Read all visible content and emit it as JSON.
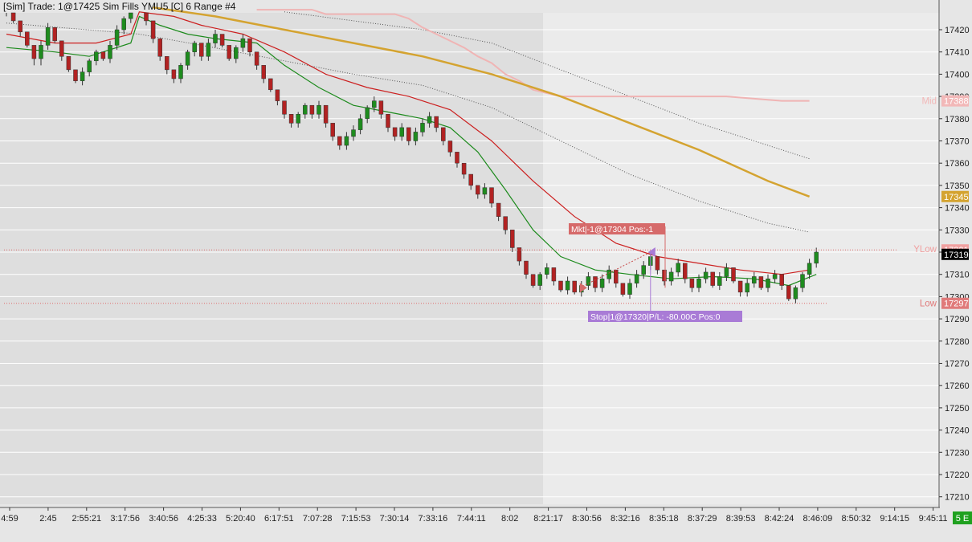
{
  "header": {
    "title": "[Sim]  Trade: 1@17425   Sim Fills  YMU5 [C]  6 Range  #4"
  },
  "price_axis": {
    "ticks": [
      "17420",
      "17410",
      "17400",
      "17390",
      "17380",
      "17370",
      "17360",
      "17350",
      "17340",
      "17330",
      "17320",
      "17310",
      "17300",
      "17290",
      "17280",
      "17270",
      "17260",
      "17250",
      "17240",
      "17230",
      "17220",
      "17210"
    ],
    "tags": {
      "mid": {
        "label": "Mid",
        "value": "17388",
        "color": "#f2b8b8"
      },
      "yellow_ma": {
        "value": "17345",
        "color": "#d4a330"
      },
      "ylow": {
        "label": "YLow",
        "value": "17321",
        "color": "#f0a0a0"
      },
      "last": {
        "value": "17319",
        "color": "#000000"
      },
      "low": {
        "label": "Low",
        "value": "17297",
        "color": "#e07a7a"
      }
    }
  },
  "time_axis": {
    "labels": [
      "4:59",
      "2:45",
      "2:55:21",
      "3:17:56",
      "3:40:56",
      "4:25:33",
      "5:20:40",
      "6:17:51",
      "7:07:28",
      "7:15:53",
      "7:30:14",
      "7:33:16",
      "7:44:11",
      "8:02",
      "8:21:17",
      "8:30:56",
      "8:32:16",
      "8:35:18",
      "8:37:29",
      "8:39:53",
      "8:42:24",
      "8:46:09",
      "8:50:32",
      "9:14:15",
      "9:45:11"
    ],
    "corner_label": "5 E"
  },
  "annotations": {
    "entry_label": "Mkt|-1@17304 Pos:-1",
    "exit_label": "Stop|1@17320|P/L: -80.00C Pos:0"
  },
  "colors": {
    "up_candle": "#1e8c1e",
    "down_candle": "#b22222",
    "green_ma": "#1c8a1c",
    "red_ma": "#cc2020",
    "yellow_ma": "#d4a330",
    "grey_ma": "#555555",
    "entry_color": "#d66a6a",
    "exit_color": "#a97bd6"
  },
  "chart_data": {
    "type": "candlestick",
    "instrument": "YMU5",
    "bar_type": "6 Range",
    "ylim": [
      17204,
      17430
    ],
    "grid": true,
    "legend": "none",
    "candles": [
      [
        17431,
        17430,
        17426,
        17428
      ],
      [
        17428,
        17425,
        17423,
        17424
      ],
      [
        17424,
        17422,
        17417,
        17419
      ],
      [
        17419,
        17418,
        17412,
        17413
      ],
      [
        17413,
        17412,
        17404,
        17407
      ],
      [
        17407,
        17415,
        17404,
        17413
      ],
      [
        17413,
        17423,
        17411,
        17421
      ],
      [
        17421,
        17420,
        17414,
        17415
      ],
      [
        17415,
        17414,
        17406,
        17408
      ],
      [
        17408,
        17407,
        17401,
        17402
      ],
      [
        17402,
        17401,
        17396,
        17397
      ],
      [
        17397,
        17403,
        17395,
        17401
      ],
      [
        17401,
        17407,
        17399,
        17406
      ],
      [
        17406,
        17411,
        17404,
        17410
      ],
      [
        17410,
        17409,
        17406,
        17407
      ],
      [
        17407,
        17415,
        17405,
        17413
      ],
      [
        17413,
        17422,
        17411,
        17420
      ],
      [
        17420,
        17426,
        17418,
        17425
      ],
      [
        17425,
        17429,
        17423,
        17428
      ],
      [
        17435,
        17434,
        17428,
        17430
      ],
      [
        17430,
        17429,
        17422,
        17424
      ],
      [
        17424,
        17423,
        17414,
        17416
      ],
      [
        17416,
        17415,
        17406,
        17408
      ],
      [
        17408,
        17407,
        17400,
        17402
      ],
      [
        17402,
        17401,
        17396,
        17398
      ],
      [
        17398,
        17405,
        17396,
        17404
      ],
      [
        17404,
        17411,
        17402,
        17410
      ],
      [
        17410,
        17415,
        17408,
        17414
      ],
      [
        17414,
        17413,
        17406,
        17408
      ],
      [
        17408,
        17416,
        17406,
        17414
      ],
      [
        17414,
        17420,
        17412,
        17418
      ],
      [
        17418,
        17417,
        17412,
        17413
      ],
      [
        17413,
        17412,
        17406,
        17407
      ],
      [
        17407,
        17413,
        17405,
        17412
      ],
      [
        17412,
        17418,
        17410,
        17416
      ],
      [
        17416,
        17415,
        17408,
        17410
      ],
      [
        17410,
        17409,
        17402,
        17404
      ],
      [
        17404,
        17403,
        17396,
        17398
      ],
      [
        17398,
        17397,
        17392,
        17393
      ],
      [
        17393,
        17392,
        17386,
        17388
      ],
      [
        17388,
        17387,
        17380,
        17382
      ],
      [
        17382,
        17381,
        17376,
        17378
      ],
      [
        17378,
        17383,
        17376,
        17382
      ],
      [
        17382,
        17387,
        17380,
        17386
      ],
      [
        17386,
        17385,
        17380,
        17382
      ],
      [
        17382,
        17388,
        17380,
        17386
      ],
      [
        17386,
        17385,
        17376,
        17378
      ],
      [
        17378,
        17377,
        17370,
        17372
      ],
      [
        17372,
        17371,
        17366,
        17368
      ],
      [
        17368,
        17374,
        17366,
        17372
      ],
      [
        17372,
        17377,
        17370,
        17375
      ],
      [
        17375,
        17382,
        17373,
        17380
      ],
      [
        17380,
        17386,
        17378,
        17385
      ],
      [
        17385,
        17390,
        17383,
        17388
      ],
      [
        17388,
        17387,
        17380,
        17382
      ],
      [
        17382,
        17381,
        17374,
        17376
      ],
      [
        17376,
        17375,
        17370,
        17372
      ],
      [
        17372,
        17378,
        17370,
        17376
      ],
      [
        17376,
        17375,
        17368,
        17370
      ],
      [
        17370,
        17376,
        17368,
        17374
      ],
      [
        17374,
        17380,
        17372,
        17378
      ],
      [
        17378,
        17383,
        17376,
        17381
      ],
      [
        17381,
        17380,
        17374,
        17376
      ],
      [
        17376,
        17375,
        17368,
        17370
      ],
      [
        17370,
        17369,
        17363,
        17365
      ],
      [
        17365,
        17364,
        17358,
        17360
      ],
      [
        17360,
        17359,
        17353,
        17355
      ],
      [
        17355,
        17354,
        17348,
        17350
      ],
      [
        17350,
        17349,
        17344,
        17346
      ],
      [
        17346,
        17351,
        17344,
        17349
      ],
      [
        17349,
        17348,
        17340,
        17342
      ],
      [
        17342,
        17341,
        17334,
        17336
      ],
      [
        17336,
        17335,
        17328,
        17330
      ],
      [
        17330,
        17329,
        17320,
        17322
      ],
      [
        17322,
        17321,
        17314,
        17316
      ],
      [
        17316,
        17315,
        17308,
        17310
      ],
      [
        17310,
        17309,
        17304,
        17305
      ],
      [
        17305,
        17311,
        17303,
        17310
      ],
      [
        17310,
        17315,
        17308,
        17313
      ],
      [
        17313,
        17312,
        17305,
        17307
      ],
      [
        17307,
        17306,
        17302,
        17303
      ],
      [
        17303,
        17309,
        17301,
        17307
      ],
      [
        17307,
        17306,
        17301,
        17302
      ],
      [
        17302,
        17307,
        17300,
        17305
      ],
      [
        17305,
        17311,
        17303,
        17309
      ],
      [
        17309,
        17308,
        17302,
        17304
      ],
      [
        17304,
        17310,
        17302,
        17308
      ],
      [
        17308,
        17314,
        17306,
        17312
      ],
      [
        17312,
        17311,
        17304,
        17306
      ],
      [
        17306,
        17305,
        17300,
        17301
      ],
      [
        17301,
        17308,
        17299,
        17306
      ],
      [
        17306,
        17312,
        17304,
        17310
      ],
      [
        17310,
        17316,
        17308,
        17314
      ],
      [
        17314,
        17320,
        17312,
        17318
      ],
      [
        17318,
        17317,
        17310,
        17312
      ],
      [
        17312,
        17311,
        17305,
        17307
      ],
      [
        17307,
        17313,
        17305,
        17311
      ],
      [
        17311,
        17317,
        17309,
        17315
      ],
      [
        17315,
        17314,
        17306,
        17308
      ],
      [
        17308,
        17307,
        17302,
        17304
      ],
      [
        17304,
        17310,
        17302,
        17308
      ],
      [
        17308,
        17313,
        17306,
        17311
      ],
      [
        17311,
        17310,
        17304,
        17305
      ],
      [
        17305,
        17311,
        17303,
        17309
      ],
      [
        17309,
        17315,
        17307,
        17313
      ],
      [
        17313,
        17312,
        17306,
        17307
      ],
      [
        17307,
        17306,
        17300,
        17302
      ],
      [
        17302,
        17308,
        17300,
        17306
      ],
      [
        17306,
        17311,
        17304,
        17309
      ],
      [
        17309,
        17308,
        17303,
        17304
      ],
      [
        17304,
        17310,
        17302,
        17308
      ],
      [
        17308,
        17312,
        17306,
        17310
      ],
      [
        17310,
        17309,
        17303,
        17305
      ],
      [
        17305,
        17304,
        17298,
        17299
      ],
      [
        17299,
        17305,
        17297,
        17304
      ],
      [
        17304,
        17311,
        17302,
        17310
      ],
      [
        17310,
        17317,
        17308,
        17315
      ],
      [
        17315,
        17322,
        17313,
        17320
      ]
    ],
    "moving_averages": {
      "green": [
        [
          0,
          17412
        ],
        [
          7,
          17410
        ],
        [
          12,
          17408
        ],
        [
          18,
          17414
        ],
        [
          19,
          17426
        ],
        [
          22,
          17422
        ],
        [
          26,
          17418
        ],
        [
          30,
          17416
        ],
        [
          36,
          17414
        ],
        [
          40,
          17404
        ],
        [
          45,
          17394
        ],
        [
          50,
          17386
        ],
        [
          55,
          17383
        ],
        [
          60,
          17380
        ],
        [
          64,
          17376
        ],
        [
          68,
          17365
        ],
        [
          72,
          17348
        ],
        [
          76,
          17330
        ],
        [
          80,
          17318
        ],
        [
          85,
          17312
        ],
        [
          90,
          17310
        ],
        [
          96,
          17308
        ],
        [
          102,
          17309
        ],
        [
          108,
          17308
        ],
        [
          113,
          17305
        ],
        [
          117,
          17310
        ]
      ],
      "red": [
        [
          0,
          17418
        ],
        [
          7,
          17414
        ],
        [
          13,
          17414
        ],
        [
          18,
          17418
        ],
        [
          19,
          17428
        ],
        [
          24,
          17426
        ],
        [
          28,
          17422
        ],
        [
          34,
          17418
        ],
        [
          40,
          17410
        ],
        [
          46,
          17400
        ],
        [
          52,
          17394
        ],
        [
          58,
          17390
        ],
        [
          64,
          17384
        ],
        [
          70,
          17370
        ],
        [
          76,
          17352
        ],
        [
          82,
          17336
        ],
        [
          88,
          17324
        ],
        [
          94,
          17318
        ],
        [
          100,
          17315
        ],
        [
          106,
          17312
        ],
        [
          112,
          17310
        ],
        [
          116,
          17312
        ]
      ],
      "yellow": [
        [
          21,
          17430
        ],
        [
          30,
          17426
        ],
        [
          40,
          17420
        ],
        [
          50,
          17414
        ],
        [
          60,
          17408
        ],
        [
          70,
          17400
        ],
        [
          80,
          17390
        ],
        [
          90,
          17378
        ],
        [
          100,
          17366
        ],
        [
          110,
          17352
        ],
        [
          116,
          17345
        ]
      ],
      "grey_upper": [
        [
          40,
          17428
        ],
        [
          60,
          17420
        ],
        [
          70,
          17414
        ],
        [
          80,
          17402
        ],
        [
          90,
          17390
        ],
        [
          100,
          17378
        ],
        [
          110,
          17368
        ],
        [
          116,
          17362
        ]
      ],
      "grey_lower": [
        [
          0,
          17423
        ],
        [
          19,
          17418
        ],
        [
          28,
          17413
        ],
        [
          40,
          17406
        ],
        [
          50,
          17400
        ],
        [
          60,
          17395
        ],
        [
          70,
          17385
        ],
        [
          80,
          17370
        ],
        [
          90,
          17355
        ],
        [
          100,
          17343
        ],
        [
          110,
          17333
        ],
        [
          116,
          17329
        ]
      ],
      "pink_steps": [
        [
          36,
          17429
        ],
        [
          44,
          17429
        ],
        [
          46,
          17427
        ],
        [
          56,
          17427
        ],
        [
          58,
          17425
        ],
        [
          60,
          17421
        ],
        [
          62,
          17418
        ],
        [
          64,
          17415
        ],
        [
          66,
          17412
        ],
        [
          68,
          17408
        ],
        [
          70,
          17405
        ],
        [
          72,
          17400
        ],
        [
          74,
          17397
        ],
        [
          76,
          17393
        ],
        [
          80,
          17390
        ],
        [
          98,
          17390
        ],
        [
          104,
          17390
        ],
        [
          108,
          17389
        ],
        [
          112,
          17388
        ],
        [
          116,
          17388
        ]
      ]
    },
    "levels": {
      "ylow": 17321,
      "low": 17297
    },
    "trades": [
      {
        "side": "sell",
        "price": 17304,
        "bar": 83
      },
      {
        "side": "buy",
        "price": 17320,
        "bar": 93
      }
    ]
  }
}
